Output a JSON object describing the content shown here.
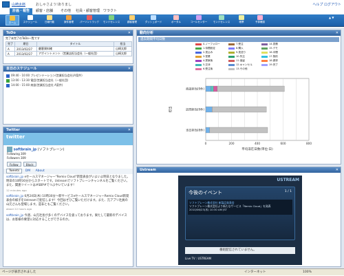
{
  "header": {
    "user": "山崎太郎",
    "greeting": "おしゃさよう!ありまし",
    "links": "ヘルプ ログアウト",
    "menus": [
      "計画・報告",
      "顧客・店舗",
      "その他",
      "社員・顧客管理",
      "ワラクト"
    ]
  },
  "toolbar": {
    "items": [
      "ホーム",
      "スケジュール",
      "日報行動",
      "案件管理",
      "パーソントラック",
      "モンドセレンス",
      "顧客管理",
      "ダッシュボード",
      "ポータル",
      "コールセンター",
      "モンドセレンス",
      "帳票",
      "予算確認"
    ]
  },
  "todo": {
    "title": "ToDo",
    "subtitle": "完了未完了のToDo一覧です",
    "headers": [
      "完了",
      "期日",
      "タイトル",
      "担当"
    ],
    "rows": [
      {
        "check": "A",
        "date": "2013/02/27",
        "title": "顧客資料確",
        "owner": "山崎太郎"
      },
      {
        "check": "A",
        "date": "2013/02/27",
        "title": "アポイントメント（営業店担当会社（一般社団）",
        "owner": "山崎太郎"
      }
    ]
  },
  "schedule": {
    "title": "本日のスケジュール",
    "items": [
      {
        "time": "09:40 - 10:00",
        "text": "プレゼンテーション(営業担当会社(A案件)",
        "color": "#2b63c9"
      },
      {
        "time": "13:00 - 13:30",
        "text": "電話(営業担当会社（一般社団）",
        "color": "#3aa33a"
      },
      {
        "time": "14:00 - 15:00",
        "text": "商談(営業担当会社 A案件)",
        "color": "#2b63c9"
      }
    ]
  },
  "twitter": {
    "title": "Twitter",
    "logo": "twitter",
    "handle": "softbrain_jp",
    "handle_name": "(ソフトブレーン)",
    "following": "Following 309",
    "followers": "Followers 309",
    "follow_btn": "Follow",
    "block_btn": "Block",
    "tabs": [
      "Tweets",
      "DM",
      "About"
    ],
    "tweets": [
      {
        "user": "softbrain_jp",
        "text": "eセールスマネージャー\"Remix Cloud\"新発表会がいよいよ明日となりました。明日の10時30分からスタートです。Ustreamでソフトブレーンチャンネルをご覧ください。また、関連ツイートは#SBP#でつぶやいています！",
        "time": "12 minutes ago"
      },
      {
        "user": "softbrain_jp",
        "text": "6月24日(木) 10時30分〜新サービスeセールスマネージャーRemix Cloud新発表会の様子をUstreamで配信します！今回はぜひご覧いただけます。また、元アプリ社員の山元さんも登場します。是非ともご覧ください。",
        "time": "about 22 hours ago"
      },
      {
        "user": "softbrain_jp",
        "text": "今週、山元社長が多くのデバイスを扱っております。果たして最新のデバイスは、お客様の要望に対応することができるのか。",
        "time": ""
      }
    ]
  },
  "analysis": {
    "title": "動向分析",
    "chart_header": "過去期間平均日数",
    "legend": [
      "0.ノーフォロー",
      "1.待間設定",
      "2.見込み",
      "3.営業",
      "4.提案後",
      "5.交渉",
      "6.受注後",
      "7.受注",
      "8.購入",
      "9.見送り",
      "10.失注",
      "11.保留",
      "12.キャンセル",
      "13.その他",
      "14.見積",
      "15.デモ",
      "16.中間",
      "17.契約",
      "18.請求",
      "19.完了"
    ],
    "legend_colors": [
      "#e04848",
      "#48a848",
      "#4868e0",
      "#e0a030",
      "#a040c0",
      "#40b8b8",
      "#e070a0",
      "#9c6a3a",
      "#7c7cff",
      "#b0b030",
      "#2aa070",
      "#d05a5a",
      "#5a8ad0",
      "#c0c0c0",
      "#8060a0",
      "#60a060",
      "#e0e060",
      "#30c0e0",
      "#ff8040",
      "#a0a0ff"
    ]
  },
  "chart_data": {
    "type": "bar",
    "orientation": "horizontal",
    "stacked": true,
    "categories": [
      "商談担当(9件)",
      "訪問担当(9件)",
      "当日担当(8件)"
    ],
    "series": [
      {
        "name": "ノーフォロー",
        "values": [
          40,
          50,
          30
        ],
        "color": "#6fb1ea"
      },
      {
        "name": "見込み",
        "values": [
          20,
          0,
          0
        ],
        "color": "#58c4b8"
      },
      {
        "name": "営業",
        "values": [
          30,
          0,
          0
        ],
        "color": "#d65aa0"
      },
      {
        "name": "提案後",
        "values": [
          520,
          420,
          450
        ],
        "color": "#c2c2c2"
      }
    ],
    "xlabel": "平均滞在日数(単位:日)",
    "xlim": [
      0,
      800
    ],
    "xticks": [
      "0",
      "200",
      "400",
      "600",
      "800"
    ],
    "ylabel": "担当"
  },
  "ustream": {
    "title": "Ustream",
    "brand": "USTREAM",
    "event_title": "今後のイベント",
    "event_page": "1 / 1",
    "event_line1": "ソフトブレーン株式会社 新製品発表会",
    "event_line2": "ソフトブレーン株式会社より新たなサービス「Remix Cloud」を発表",
    "event_date": "2010/06/23(水) 10:30 AM JST",
    "offline": "番組配信されていません。",
    "live_text": "Live TV : USTREAM"
  },
  "status": {
    "text": "ページが表示されました",
    "zone": "インターネット",
    "zoom": "100%"
  }
}
